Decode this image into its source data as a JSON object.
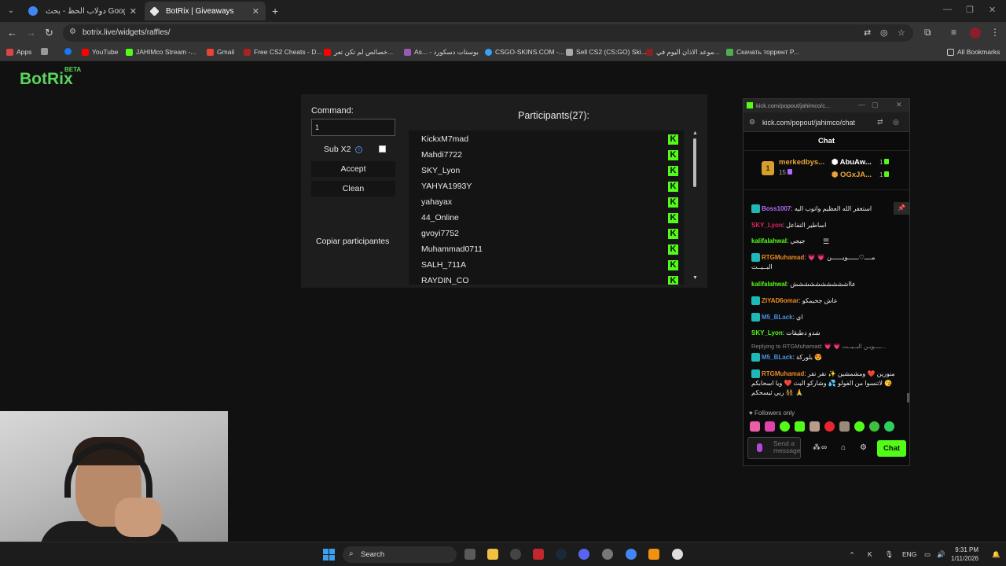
{
  "browser": {
    "tabs": [
      {
        "title": "دولاب الحظ - بحث Google",
        "favicon_color": "#4285f4"
      },
      {
        "title": "BotRix | Giveaways",
        "favicon_color": "#e8e8e8"
      }
    ],
    "url": "botrix.live/widgets/raffles/",
    "bookmarks": [
      {
        "label": "Apps",
        "color": "#e55"
      },
      {
        "label": "YouTube",
        "color": "#ff0000"
      },
      {
        "label": "JAHIMco Stream -...",
        "color": "#53fc18"
      },
      {
        "label": "Gmail",
        "color": "#ea4335"
      },
      {
        "label": "Free CS2 Cheats - D...",
        "color": "#a22"
      },
      {
        "label": "خصائص لم تكن تعر...",
        "color": "#ff0000"
      },
      {
        "label": "As... - بوستات دسكورد",
        "color": "#9b59b6"
      },
      {
        "label": "CSGO-SKINS.COM -...",
        "color": "#3aa0f2"
      },
      {
        "label": "Sell CS2 (CS:GO) Ski...",
        "color": "#aaa"
      },
      {
        "label": "موعد الاذان اليوم في...",
        "color": "#822"
      },
      {
        "label": "Скачать торрент P...",
        "color": "#4caf50"
      }
    ],
    "all_bookmarks": "All Bookmarks"
  },
  "app": {
    "logo": "BotRix",
    "logo_badge": "BETA"
  },
  "raffle": {
    "command_label": "Command:",
    "command_value": "1",
    "sub_label": "Sub X2",
    "accept": "Accept",
    "clean": "Clean",
    "copy": "Copiar participantes",
    "participants_title": "Participants(27):",
    "participants": [
      "KickxM7mad",
      "Mahdi7722",
      "SKY_Lyon",
      "YAHYA1993Y",
      "yahayax",
      "44_Online",
      "gvoyi7752",
      "Muhammad0711",
      "SALH_711A",
      "RAYDIN_CO"
    ]
  },
  "popup": {
    "window_title": "kick.com/popout/jahimco/c...",
    "url": "kick.com/popout/jahimco/chat",
    "header": "Chat",
    "leaders": [
      {
        "name": "merkedbys...",
        "count": "15",
        "color": "#e8a33a"
      },
      {
        "name": "AbuAw...",
        "count": "1",
        "color": "#ffffff"
      },
      {
        "name": "OGxJA...",
        "count": "1",
        "color": "#e8a33a"
      }
    ],
    "messages": [
      {
        "user": "Boss1007",
        "color": "#b36bff",
        "text": "استغفر الله العظيم واتوب اليه",
        "badge": true
      },
      {
        "user": "SKY_Lyon",
        "color": "#e0245e",
        "text": "اساطير التفاعل",
        "badge": false
      },
      {
        "user": "kalifalahwal",
        "color": "#53fc18",
        "text": "جيجي",
        "badge": false
      },
      {
        "user": "RTGMuhamad",
        "color": "#f08a24",
        "text": "💗 💗 مــــ♡ــــــويــــــن البــيــت",
        "badge": true
      },
      {
        "user": "kalifalahwal",
        "color": "#53fc18",
        "text": "عااشششششششششش",
        "badge": false
      },
      {
        "user": "ZIYAD6omar",
        "color": "#f08a24",
        "text": "عاش جحيمكو",
        "badge": true
      },
      {
        "user": "M5_BLack",
        "color": "#4a90e2",
        "text": "اي",
        "badge": true
      },
      {
        "user": "SKY_Lyon",
        "color": "#53fc18",
        "text": "شدو دطيقات",
        "badge": false
      },
      {
        "user": "M5_BLack",
        "color": "#4a90e2",
        "text": "بلوركة 😍",
        "badge": true
      },
      {
        "user": "RTGMuhamad",
        "color": "#f08a24",
        "text": "منورين ❤️ ومشمشين ✨ نفر نفر 😘 لاتنسوا من الفولو 💦 وشاركو البث ❤️ ويا اسحابكم 👯 ربي ئيسحكم 🙏",
        "badge": true
      }
    ],
    "reply_to": "Replying to RTGMuhamad: 💗 💗 ــــويـن البــيــت...",
    "followers_only": "Followers only",
    "input_placeholder": "Send a message",
    "chat_button": "Chat"
  },
  "taskbar": {
    "search": "Search",
    "lang": "ENG",
    "time": "9:31 PM",
    "date": "1/11/2026"
  }
}
